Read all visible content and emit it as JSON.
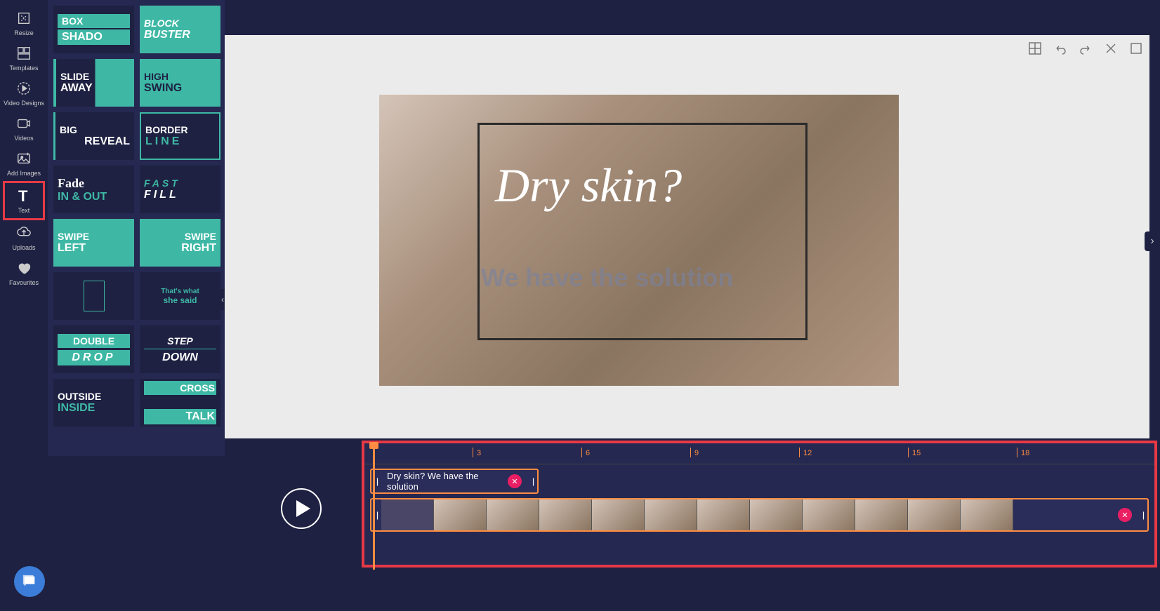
{
  "sidebar": {
    "items": [
      {
        "label": "Resize",
        "icon": "resize-icon"
      },
      {
        "label": "Templates",
        "icon": "templates-icon"
      },
      {
        "label": "Video Designs",
        "icon": "video-designs-icon"
      },
      {
        "label": "Videos",
        "icon": "videos-icon"
      },
      {
        "label": "Add Images",
        "icon": "add-images-icon"
      },
      {
        "label": "Text",
        "icon": "text-icon"
      },
      {
        "label": "Uploads",
        "icon": "uploads-icon"
      },
      {
        "label": "Favourites",
        "icon": "favourites-icon"
      }
    ]
  },
  "text_effects": [
    {
      "line1": "BOX",
      "line2": "SHADO"
    },
    {
      "line1": "BLOCK",
      "line2": "BUSTER"
    },
    {
      "line1": "SLIDE",
      "line2": "AWAY"
    },
    {
      "line1": "HIGH",
      "line2": "SWING"
    },
    {
      "line1": "BIG",
      "line2": "REVEAL"
    },
    {
      "line1": "BORDER",
      "line2": "LINE"
    },
    {
      "line1": "Fade",
      "line2": "IN & OUT"
    },
    {
      "line1": "FAST",
      "line2": "FILL"
    },
    {
      "line1": "SWIPE",
      "line2": "LEFT"
    },
    {
      "line1": "SWIPE",
      "line2": "RIGHT"
    },
    {
      "line1": "",
      "line2": ""
    },
    {
      "line1": "That's what",
      "line2": "she said"
    },
    {
      "line1": "DOUBLE",
      "line2": "DROP"
    },
    {
      "line1": "STEP",
      "line2": "DOWN"
    },
    {
      "line1": "OUTSIDE",
      "line2": "INSIDE"
    },
    {
      "line1": "CROSS",
      "line2": "TALK"
    }
  ],
  "canvas": {
    "title": "Dry skin?",
    "subtitle": "We have the solution"
  },
  "timeline": {
    "marks": [
      "3",
      "6",
      "9",
      "12",
      "15",
      "18"
    ],
    "text_track": "Dry skin? We have the solution"
  }
}
